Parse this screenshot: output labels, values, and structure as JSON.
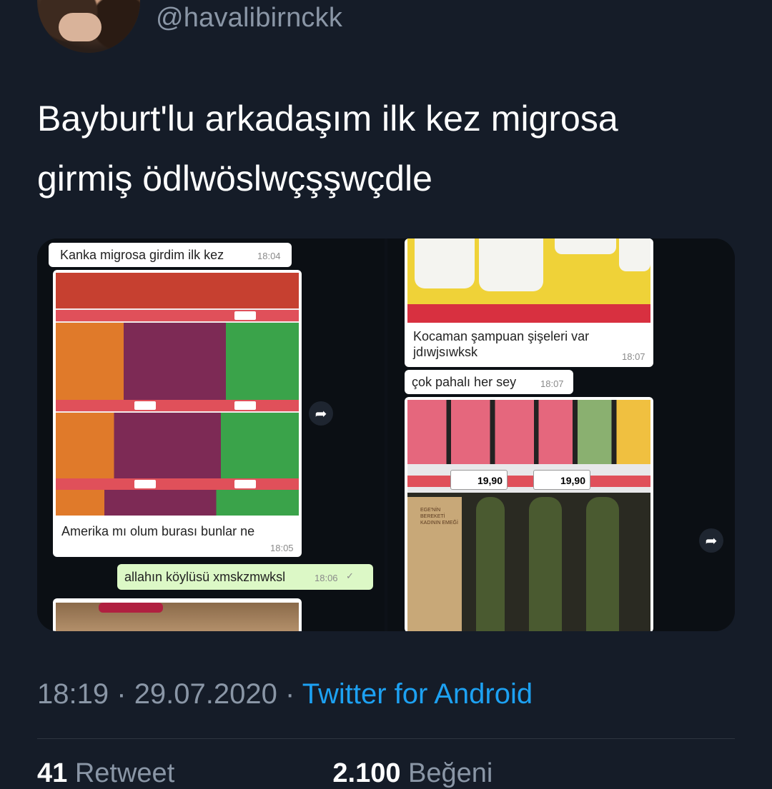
{
  "profile": {
    "handle": "@havalibirnckk"
  },
  "tweet": {
    "text": "Bayburt'lu arkadaşım ilk kez migrosa girmiş  ödlwöslwçşşwçdle"
  },
  "chat_left": {
    "msg1": {
      "text": "Kanka migrosa girdim ilk kez",
      "time": "18:04"
    },
    "msg2": {
      "text": "Amerika mı olum burası bunlar ne",
      "time": "18:05"
    },
    "msg3": {
      "text": "allahın köylüsü xmskzmwksl",
      "time": "18:06",
      "ticks": "✓"
    }
  },
  "chat_right": {
    "msg1": {
      "text": "Kocaman şampuan şişeleri var jdıwjsıwksk",
      "time": "18:07"
    },
    "msg2": {
      "text": "çok pahalı her sey",
      "time": "18:07"
    },
    "price1": "19,90",
    "price2": "19,90",
    "box_text": "EGE'NİN BEREKETİ KADININ EMEĞİ"
  },
  "meta": {
    "time": "18:19",
    "date": "29.07.2020",
    "sep": "·",
    "source": "Twitter for Android"
  },
  "stats": {
    "retweets_count": "41",
    "retweets_label": "Retweet",
    "likes_count": "2.100",
    "likes_label": "Beğeni"
  },
  "colors": {
    "background": "#151c28",
    "link": "#1da1f2",
    "muted": "#8a96a6",
    "bubble_out": "#dcf8c6"
  },
  "icons": [
    "share-arrow-icon",
    "double-check-icon"
  ]
}
